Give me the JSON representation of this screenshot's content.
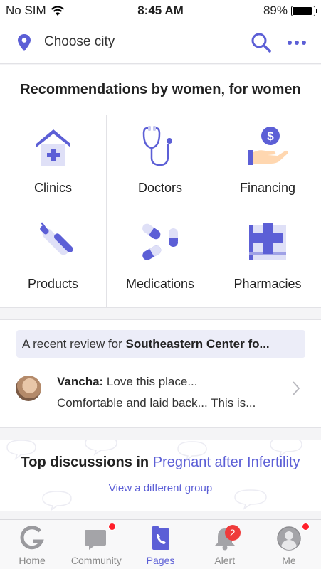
{
  "status_bar": {
    "carrier": "No SIM",
    "time": "8:45 AM",
    "battery": "89%",
    "battery_level": 0.89
  },
  "top_bar": {
    "city_label": "Choose city"
  },
  "recommendations": {
    "title": "Recommendations by women, for women",
    "items": [
      {
        "label": "Clinics",
        "icon": "clinic-house-icon"
      },
      {
        "label": "Doctors",
        "icon": "stethoscope-icon"
      },
      {
        "label": "Financing",
        "icon": "financing-hand-icon"
      },
      {
        "label": "Products",
        "icon": "thermometer-icon"
      },
      {
        "label": "Medications",
        "icon": "pills-icon"
      },
      {
        "label": "Pharmacies",
        "icon": "pharmacy-cross-icon"
      }
    ]
  },
  "review": {
    "banner_prefix": "A recent review for ",
    "banner_place": "Southeastern Center fo...",
    "author": "Vancha:",
    "line1": " Love this place...",
    "line2": "Comfortable and laid back... This is..."
  },
  "discussions": {
    "title_prefix": "Top discussions in ",
    "group": "Pregnant after Infertility",
    "link": "View a different group"
  },
  "tabbar": {
    "items": [
      {
        "label": "Home",
        "icon": "home-g-icon"
      },
      {
        "label": "Community",
        "icon": "community-chat-icon"
      },
      {
        "label": "Pages",
        "icon": "pages-phone-icon"
      },
      {
        "label": "Alert",
        "icon": "bell-icon",
        "badge": "2"
      },
      {
        "label": "Me",
        "icon": "profile-icon"
      }
    ]
  },
  "colors": {
    "accent": "#5c5fd6",
    "badge_red": "#ef3b3b",
    "banner_bg": "#ecedf8"
  }
}
